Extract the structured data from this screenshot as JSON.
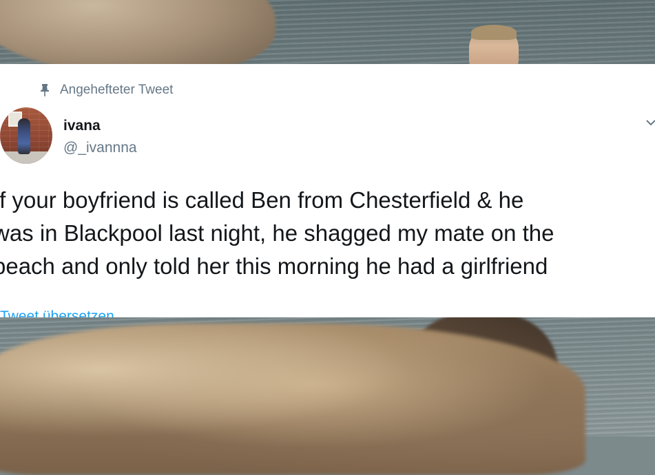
{
  "tweet": {
    "pinned_label": "Angehefteter Tweet",
    "display_name": "ivana",
    "handle": "@_ivannna",
    "text": "If your boyfriend is called Ben from Chesterfield & he\nwas in Blackpool last night, he shagged my mate on the\nbeach and only told her this morning he had a girlfriend",
    "translate_label": "Tweet übersetzen"
  },
  "icons": {
    "pin": "pin-icon",
    "more": "chevron-down-icon",
    "avatar": "avatar"
  },
  "colors": {
    "text": "#14171a",
    "secondary": "#657786",
    "link": "#1da1f2",
    "card_bg": "#ffffff"
  }
}
